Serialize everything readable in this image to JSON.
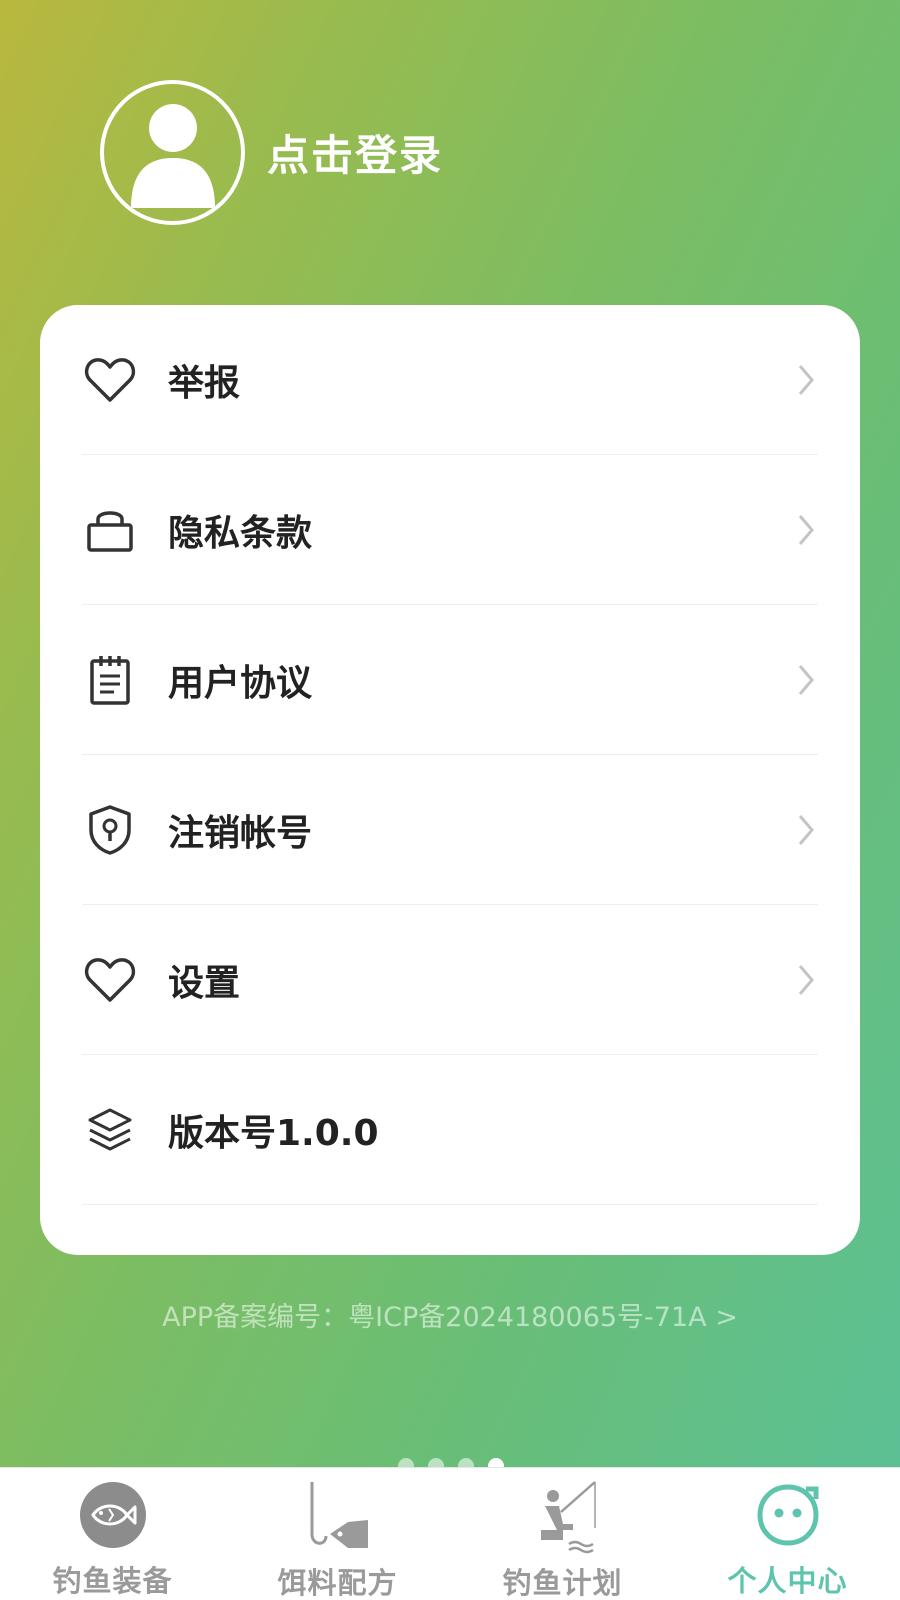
{
  "profile": {
    "login_label": "点击登录"
  },
  "menu": {
    "items": [
      {
        "label": "举报",
        "icon": "heart-icon"
      },
      {
        "label": "隐私条款",
        "icon": "lock-icon"
      },
      {
        "label": "用户协议",
        "icon": "notepad-icon"
      },
      {
        "label": "注销帐号",
        "icon": "shield-key-icon"
      },
      {
        "label": "设置",
        "icon": "heart-icon"
      },
      {
        "label": "版本号1.0.0",
        "icon": "layers-icon"
      }
    ]
  },
  "footer": {
    "icp_text": "APP备案编号：粤ICP备2024180065号-71A >"
  },
  "tabbar": {
    "tabs": [
      {
        "label": "钓鱼装备",
        "icon": "fish-icon"
      },
      {
        "label": "饵料配方",
        "icon": "hook-bait-icon"
      },
      {
        "label": "钓鱼计划",
        "icon": "angler-icon"
      },
      {
        "label": "个人中心",
        "icon": "face-icon"
      }
    ],
    "active_index": 3
  },
  "colors": {
    "accent": "#5ec4ad",
    "gradient_start": "#b9b83e",
    "gradient_end": "#5cc095"
  }
}
